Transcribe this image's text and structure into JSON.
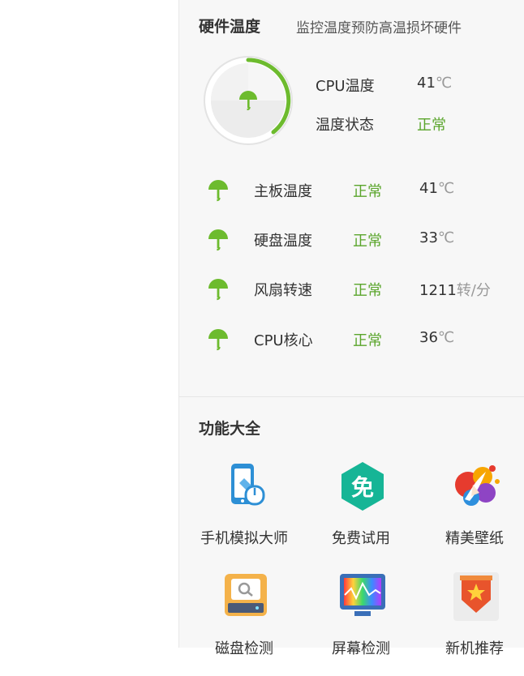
{
  "hardware": {
    "title": "硬件温度",
    "subtitle": "监控温度预防高温损坏硬件",
    "cpu_label": "CPU温度",
    "cpu_value": "41",
    "cpu_unit": "℃",
    "state_label": "温度状态",
    "state_value": "正常",
    "sensors": [
      {
        "name": "主板温度",
        "status": "正常",
        "value": "41",
        "unit": "℃"
      },
      {
        "name": "硬盘温度",
        "status": "正常",
        "value": "33",
        "unit": "℃"
      },
      {
        "name": "风扇转速",
        "status": "正常",
        "value": "1211",
        "unit": "转/分"
      },
      {
        "name": "CPU核心",
        "status": "正常",
        "value": "36",
        "unit": "℃"
      }
    ]
  },
  "functions": {
    "title": "功能大全",
    "tools": [
      {
        "label": "手机模拟大师",
        "icon": "phone-emulator-icon"
      },
      {
        "label": "免费试用",
        "icon": "free-trial-icon"
      },
      {
        "label": "精美壁纸",
        "icon": "wallpaper-icon"
      },
      {
        "label": "磁盘检测",
        "icon": "disk-check-icon"
      },
      {
        "label": "屏幕检测",
        "icon": "screen-check-icon"
      },
      {
        "label": "新机推荐",
        "icon": "new-device-icon"
      }
    ],
    "free_icon_char": "免"
  },
  "colors": {
    "accent_green": "#5aa52b",
    "panel_bg": "#f7f7f7"
  }
}
